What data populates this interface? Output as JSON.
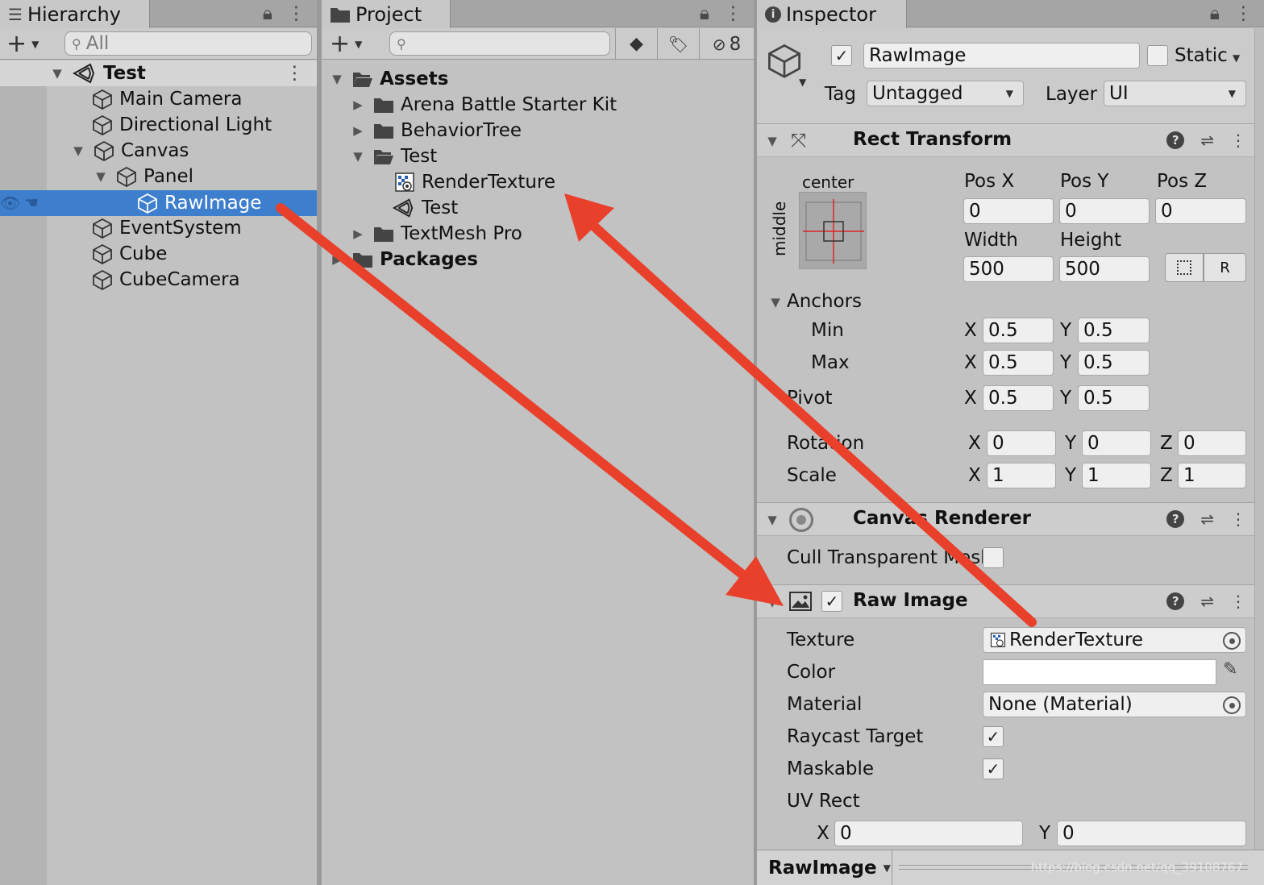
{
  "hierarchy": {
    "tab": "Hierarchy",
    "search_placeholder": "All",
    "scene": "Test",
    "items": [
      {
        "label": "Main Camera"
      },
      {
        "label": "Directional Light"
      },
      {
        "label": "Canvas"
      },
      {
        "label": "Panel"
      },
      {
        "label": "RawImage"
      },
      {
        "label": "EventSystem"
      },
      {
        "label": "Cube"
      },
      {
        "label": "CubeCamera"
      }
    ]
  },
  "project": {
    "tab": "Project",
    "hidden_count": "8",
    "items": [
      {
        "label": "Assets"
      },
      {
        "label": "Arena Battle Starter Kit"
      },
      {
        "label": "BehaviorTree"
      },
      {
        "label": "Test"
      },
      {
        "label": "RenderTexture"
      },
      {
        "label": "Test"
      },
      {
        "label": "TextMesh Pro"
      },
      {
        "label": "Packages"
      }
    ]
  },
  "inspector": {
    "tab": "Inspector",
    "object_name": "RawImage",
    "static_label": "Static",
    "tag_label": "Tag",
    "tag_value": "Untagged",
    "layer_label": "Layer",
    "layer_value": "UI",
    "rect_transform": {
      "title": "Rect Transform",
      "anchor_preset_top": "center",
      "anchor_preset_side": "middle",
      "pos_x_label": "Pos X",
      "pos_y_label": "Pos Y",
      "pos_z_label": "Pos Z",
      "pos_x": "0",
      "pos_y": "0",
      "pos_z": "0",
      "width_label": "Width",
      "height_label": "Height",
      "width": "500",
      "height": "500",
      "raw_label": "R",
      "anchors_label": "Anchors",
      "min_label": "Min",
      "max_label": "Max",
      "pivot_label": "Pivot",
      "rotation_label": "Rotation",
      "scale_label": "Scale",
      "x": "X",
      "y": "Y",
      "z": "Z",
      "min_x": "0.5",
      "min_y": "0.5",
      "max_x": "0.5",
      "max_y": "0.5",
      "pivot_x": "0.5",
      "pivot_y": "0.5",
      "rot_x": "0",
      "rot_y": "0",
      "rot_z": "0",
      "scale_x": "1",
      "scale_y": "1",
      "scale_z": "1"
    },
    "canvas_renderer": {
      "title": "Canvas Renderer",
      "cull_label": "Cull Transparent Mesh"
    },
    "raw_image": {
      "title": "Raw Image",
      "texture_label": "Texture",
      "texture_value": "RenderTexture",
      "color_label": "Color",
      "material_label": "Material",
      "material_value": "None (Material)",
      "raycast_label": "Raycast Target",
      "maskable_label": "Maskable",
      "uv_label": "UV Rect",
      "uv_x": "0",
      "uv_y": "0"
    },
    "footer_label": "RawImage",
    "watermark": "https://blog.csdn.net/qq_39108767"
  },
  "colors": {
    "selection": "#3d7ecd",
    "annotation_arrow": "#e8402a"
  }
}
